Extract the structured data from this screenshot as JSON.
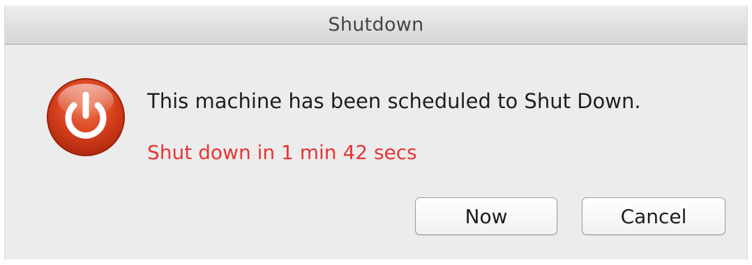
{
  "window": {
    "title": "Shutdown"
  },
  "dialog": {
    "icon": "power-icon",
    "message": "This machine has been scheduled to Shut Down.",
    "countdown": "Shut down in 1 min 42 secs",
    "countdown_color": "#e83434"
  },
  "buttons": {
    "now_label": "Now",
    "cancel_label": "Cancel"
  }
}
